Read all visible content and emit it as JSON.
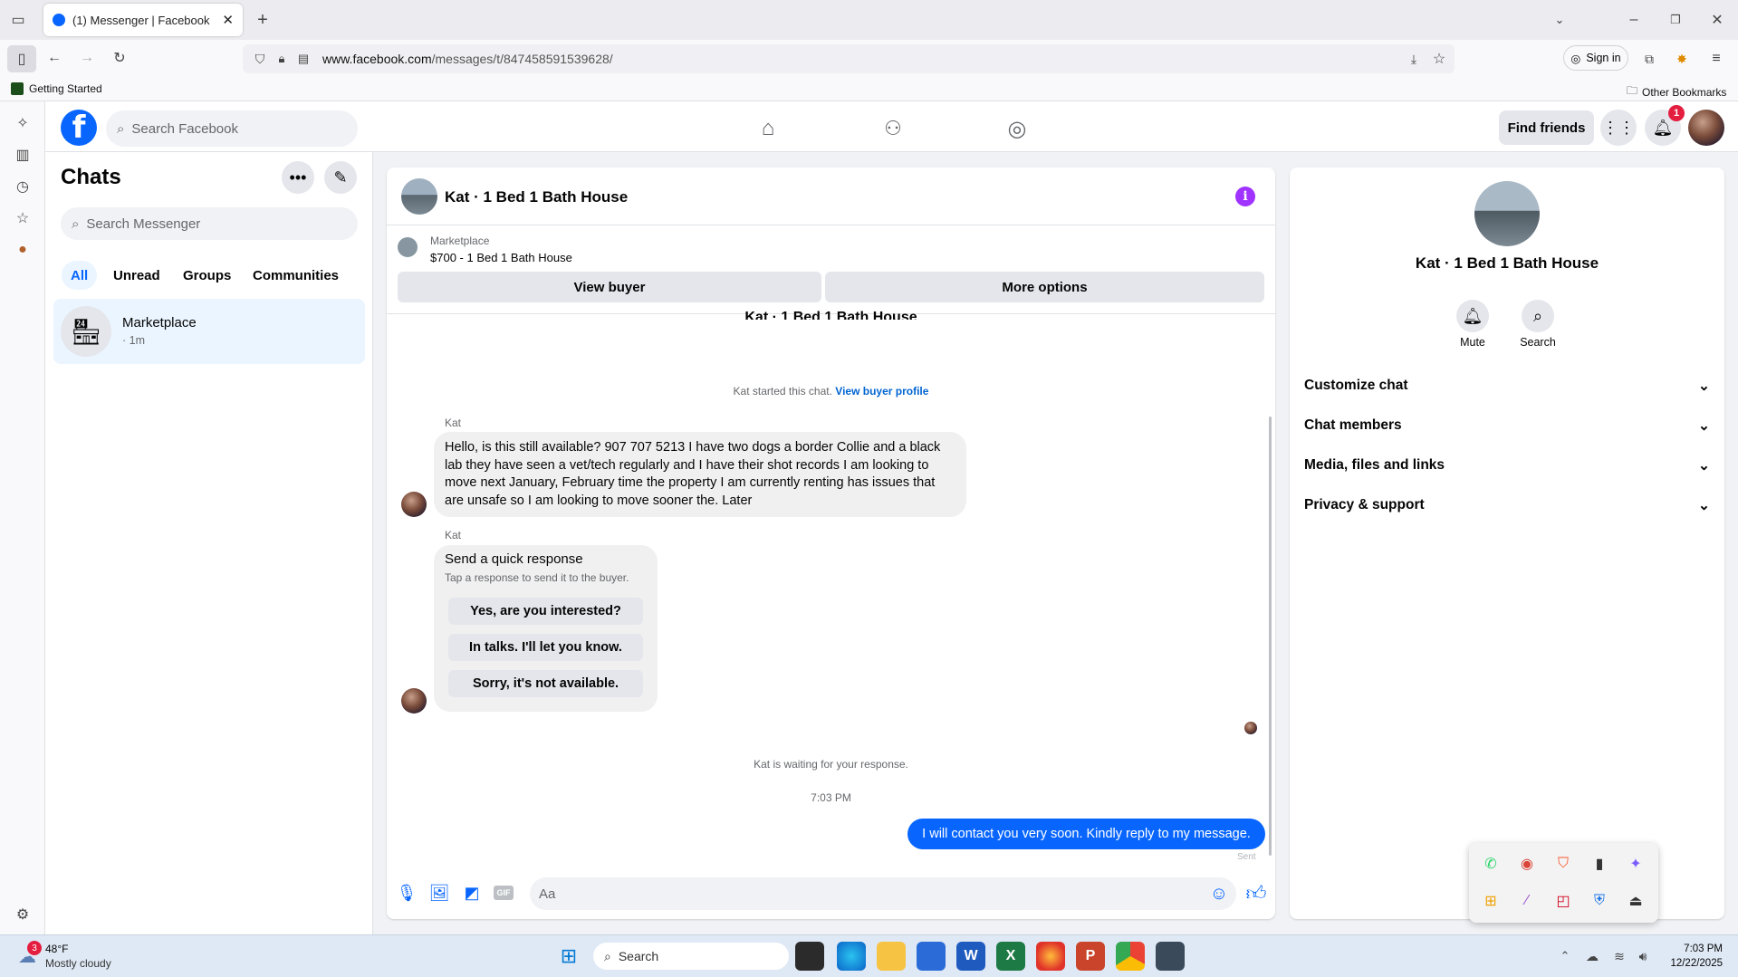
{
  "browser": {
    "tab_title": "(1) Messenger | Facebook",
    "url_host": "www.facebook.com",
    "url_path": "/messages/t/847458591539628/",
    "sign_in": "Sign in",
    "bookmark_getting_started": "Getting Started",
    "bookmark_other": "Other Bookmarks"
  },
  "fb": {
    "search_placeholder": "Search Facebook",
    "find_friends": "Find friends",
    "notif_count": "1"
  },
  "chats": {
    "title": "Chats",
    "search_placeholder": "Search Messenger",
    "filters": [
      "All",
      "Unread",
      "Groups",
      "Communities"
    ],
    "items": [
      {
        "name": "Marketplace",
        "time": "· 1m"
      }
    ]
  },
  "conversation": {
    "title": "Kat · 1 Bed 1 Bath House",
    "listing_source": "Marketplace",
    "listing_title": "$700 - 1 Bed 1 Bath House",
    "view_buyer": "View buyer",
    "more_options": "More options",
    "scrolled_title": "Kat · 1 Bed 1 Bath House",
    "started_text": "Kat started this chat.",
    "view_buyer_profile": "View buyer profile",
    "sender": "Kat",
    "msg1": "Hello, is this still available? 907 707 5213   I have two dogs a border Collie and a black lab they have seen a vet/tech regularly and I have their shot records I am looking to move next January, February time the property I am currently renting has issues that are unsafe so I am looking to move sooner the. Later",
    "quick_title": "Send a quick response",
    "quick_sub": "Tap a response to send it to the buyer.",
    "quick_options": [
      "Yes, are you interested?",
      "In talks. I'll let you know.",
      "Sorry, it's not available."
    ],
    "waiting": "Kat is waiting for your response.",
    "time": "7:03 PM",
    "my_msg": "I will contact you very soon. Kindly reply to my message.",
    "sent": "Sent",
    "composer_placeholder": "Aa"
  },
  "info": {
    "name": "Kat · 1 Bed 1 Bath House",
    "mute": "Mute",
    "search": "Search",
    "sections": [
      "Customize chat",
      "Chat members",
      "Media, files and links",
      "Privacy & support"
    ]
  },
  "taskbar": {
    "temp": "48°F",
    "weather": "Mostly cloudy",
    "weather_badge": "3",
    "search": "Search",
    "time": "7:03 PM",
    "date": "12/22/2025"
  },
  "colors": {
    "fb_blue": "#0866ff",
    "bubble_grey": "#f0f0f0",
    "selected_row": "#ebf5ff",
    "badge_red": "#e41e3f"
  }
}
